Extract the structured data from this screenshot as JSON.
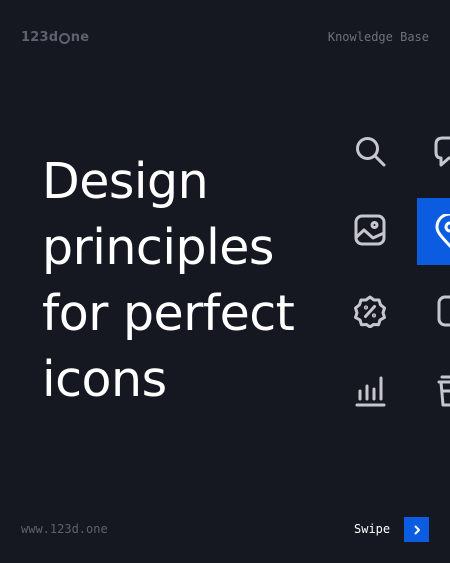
{
  "header": {
    "logo_prefix": "123d",
    "logo_suffix": "ne",
    "section_label": "Knowledge Base"
  },
  "headline": {
    "lines": [
      "Design",
      "principles",
      "for perfect",
      "icons"
    ]
  },
  "icons": [
    "search-icon",
    "image-icon",
    "percent-badge-icon",
    "bar-chart-icon",
    "chat-bubble-icon",
    "location-pin-icon",
    "square-icon",
    "cup-icon"
  ],
  "footer": {
    "url": "www.123d.one",
    "swipe_label": "Swipe",
    "swipe_icon": "chevron-right-icon"
  },
  "colors": {
    "background": "#151821",
    "accent": "#0b5ce0",
    "icon_stroke": "#c5c7cd",
    "muted_text": "#5c616d"
  }
}
